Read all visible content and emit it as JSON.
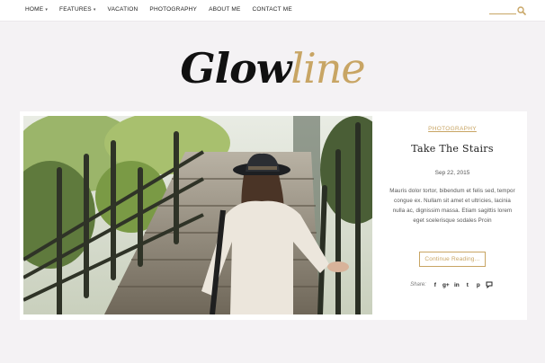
{
  "nav": {
    "items": [
      {
        "label": "HOME",
        "caret": "▾"
      },
      {
        "label": "FEATURES",
        "caret": "▾"
      },
      {
        "label": "VACATION",
        "caret": ""
      },
      {
        "label": "PHOTOGRAPHY",
        "caret": ""
      },
      {
        "label": "ABOUT ME",
        "caret": ""
      },
      {
        "label": "CONTACT ME",
        "caret": ""
      }
    ]
  },
  "logo": {
    "part1": "Glow",
    "part2": "line"
  },
  "post": {
    "category": "PHOTOGRAPHY",
    "title": "Take The Stairs",
    "date": "Sep 22, 2015",
    "excerpt": "Mauris dolor tortor, bibendum et felis sed, tempor congue ex. Nullam sit amet et ultricies, lacinia nulla ac, dignissim massa. Etiam sagittis lorem eget scelerisque sodales Proin",
    "continue_label": "Continue Reading...",
    "share_label": "Share:",
    "share_icons": [
      "f",
      "g+",
      "in",
      "t",
      "p",
      "c"
    ]
  },
  "colors": {
    "accent": "#c8a564",
    "background": "#f4f2f4",
    "text": "#222222"
  }
}
